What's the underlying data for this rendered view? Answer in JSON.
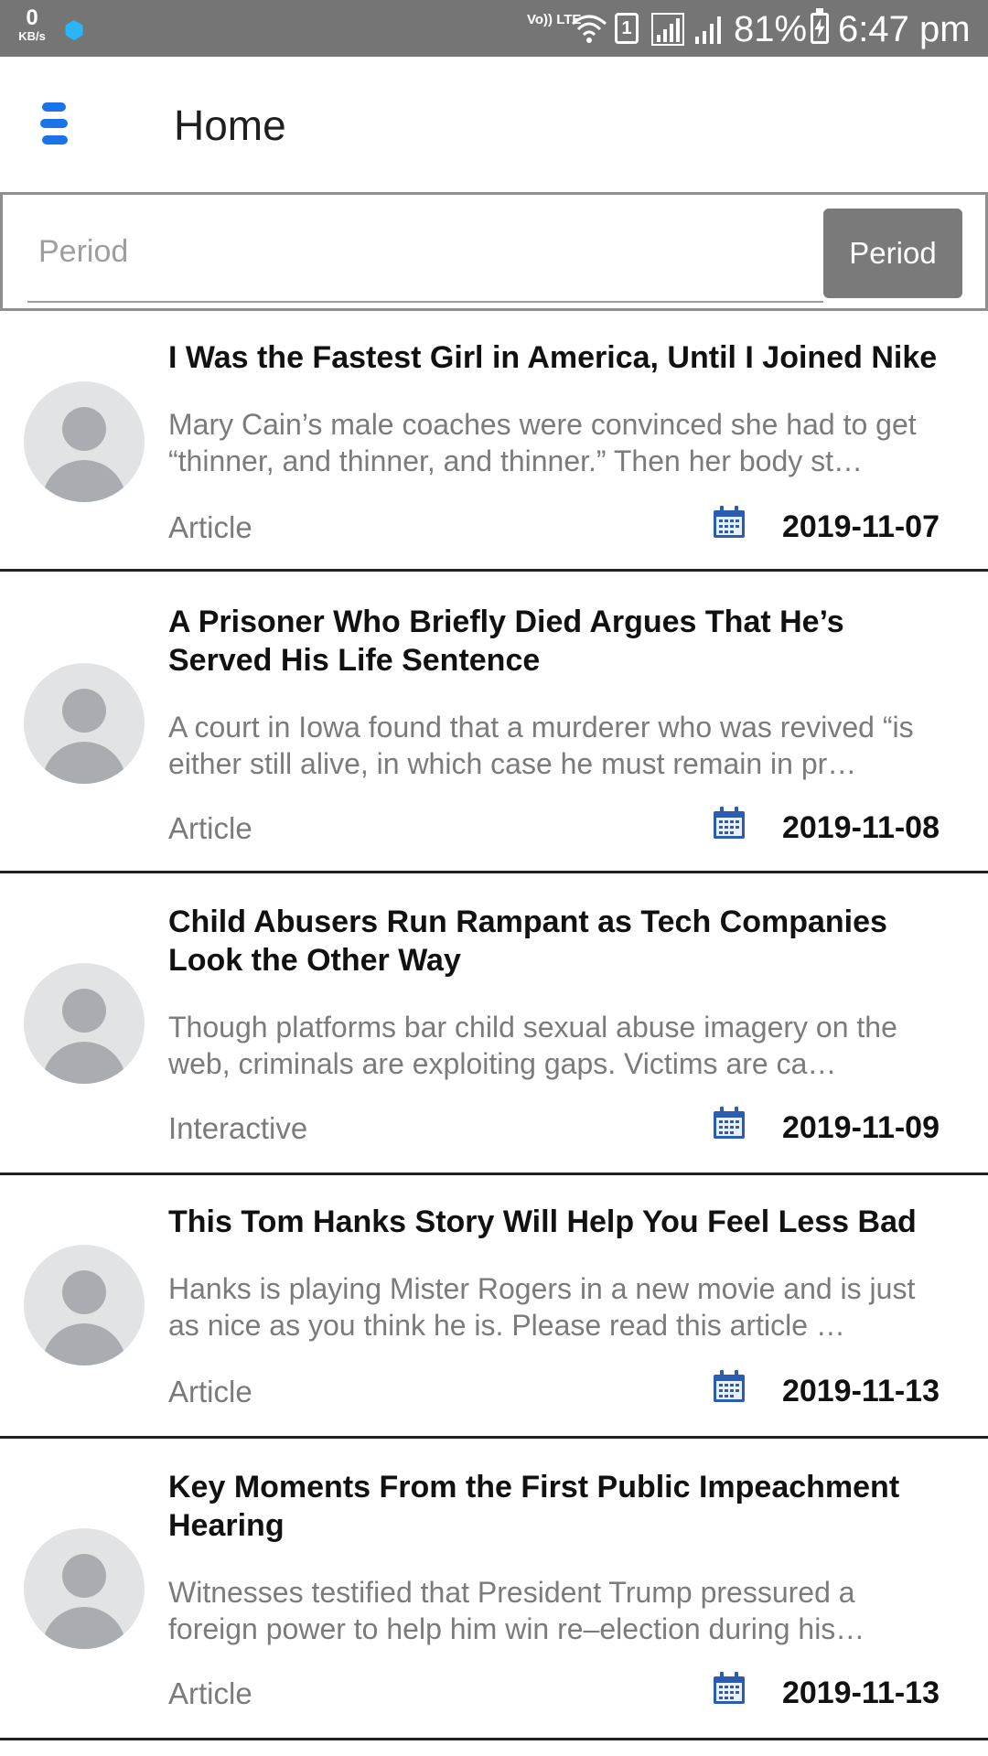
{
  "status_bar": {
    "speed_value": "0",
    "speed_unit": "KB/s",
    "volte": "Vo)) LTE",
    "sim": "1",
    "battery": "81%",
    "time": "6:47 pm"
  },
  "header": {
    "title": "Home",
    "menu_icon": "hamburger-menu-icon",
    "accent": "#1a73e8"
  },
  "search": {
    "placeholder": "Period",
    "value": "",
    "button_label": "Period"
  },
  "articles": [
    {
      "title": "I Was the Fastest Girl in America, Until I Joined Nike",
      "description": "Mary Cain’s male coaches were convinced she had to get “thinner, and thinner, and thinner.” Then her body st…",
      "type": "Article",
      "date": "2019-11-07"
    },
    {
      "title": "A Prisoner Who Briefly Died Argues That He’s Served His Life Sentence",
      "description": "A court in Iowa found that a murderer who was revived “is either still alive, in which case he must remain in pr…",
      "type": "Article",
      "date": "2019-11-08"
    },
    {
      "title": "Child Abusers Run Rampant as Tech Companies Look the Other Way",
      "description": "Though platforms bar child sexual abuse imagery on the web, criminals are exploiting gaps. Victims are ca…",
      "type": "Interactive",
      "date": "2019-11-09"
    },
    {
      "title": "This Tom Hanks Story Will Help You Feel Less Bad",
      "description": "Hanks is playing Mister Rogers in a new movie and is just as nice as you think he is. Please read this article …",
      "type": "Article",
      "date": "2019-11-13"
    },
    {
      "title": "Key Moments From the First Public Impeachment Hearing",
      "description": "Witnesses testified that President Trump pressured a foreign power to help him win re–election during his…",
      "type": "Article",
      "date": "2019-11-13"
    }
  ]
}
